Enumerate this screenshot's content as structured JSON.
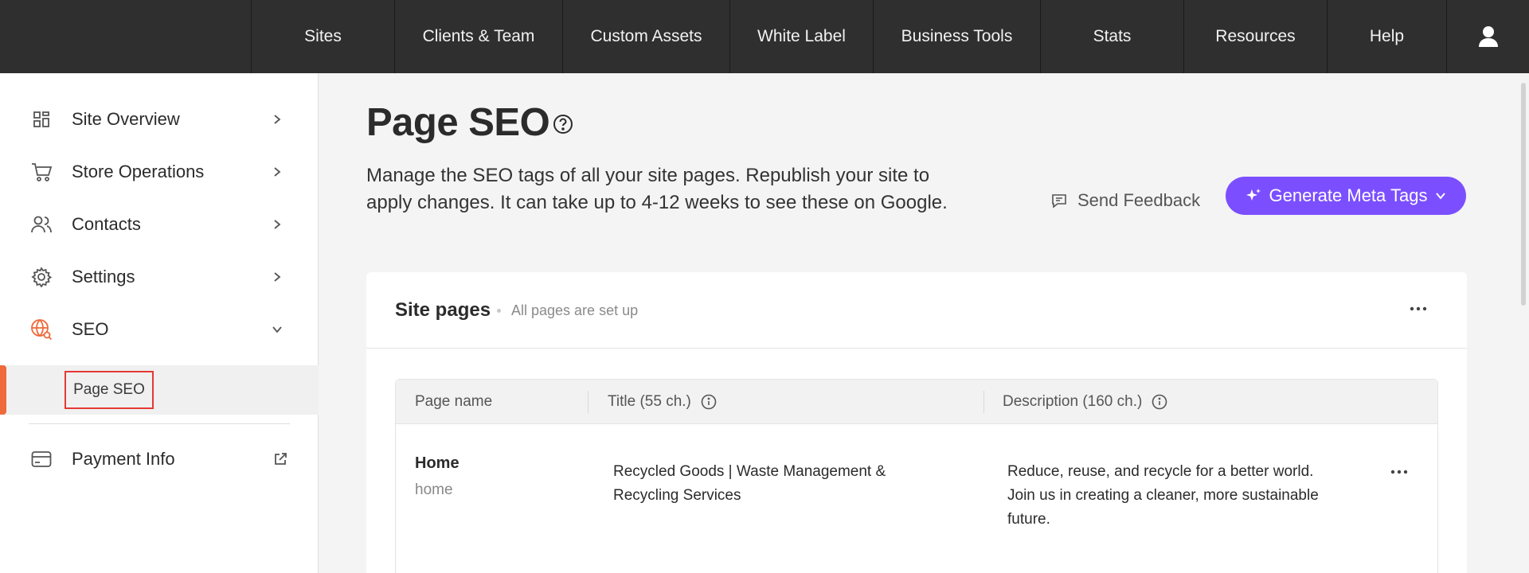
{
  "topnav": {
    "items": [
      "Sites",
      "Clients & Team",
      "Custom Assets",
      "White Label",
      "Business Tools",
      "Stats",
      "Resources",
      "Help"
    ]
  },
  "sidebar": {
    "items": [
      {
        "label": "Site Overview",
        "icon": "grid-icon"
      },
      {
        "label": "Store Operations",
        "icon": "cart-icon"
      },
      {
        "label": "Contacts",
        "icon": "people-icon"
      },
      {
        "label": "Settings",
        "icon": "gear-icon"
      },
      {
        "label": "SEO",
        "icon": "globe-search-icon"
      }
    ],
    "sub_item": "Page SEO",
    "payment": "Payment Info"
  },
  "main": {
    "title": "Page SEO",
    "intro_line1": "Manage the SEO tags of all your site pages. Republish your site to",
    "intro_line2": "apply changes. It can take up to 4-12 weeks to see these on Google.",
    "feedback": "Send Feedback",
    "generate": "Generate Meta Tags"
  },
  "card": {
    "title": "Site pages",
    "status": "All pages are set up",
    "columns": [
      "Page name",
      "Title (55 ch.)",
      "Description (160 ch.)"
    ],
    "rows": [
      {
        "name": "Home",
        "slug": "home",
        "title_line1": "Recycled Goods | Waste Management &",
        "title_line2": "Recycling Services",
        "desc_line1": "Reduce, reuse, and recycle for a better world.",
        "desc_line2": "Join us in creating a cleaner, more sustainable",
        "desc_line3": "future."
      }
    ]
  },
  "colors": {
    "nav_bg": "#2f2f2f",
    "accent": "#7b4fff",
    "seo_accent": "#ee6a3a",
    "highlight_border": "#e53935"
  }
}
